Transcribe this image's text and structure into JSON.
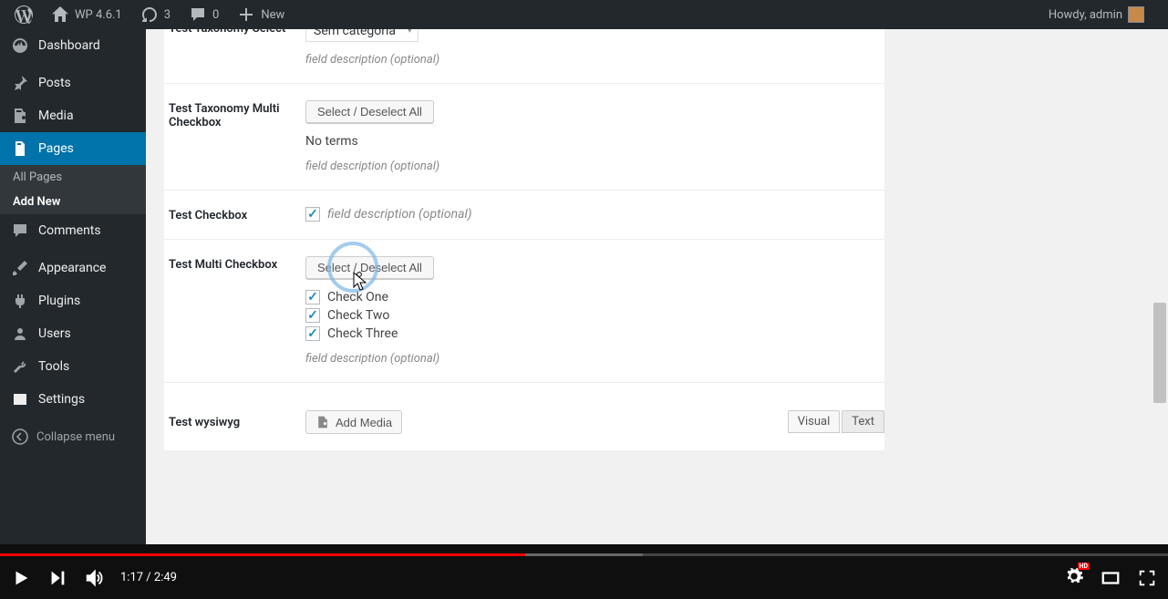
{
  "adminbar": {
    "site_title": "WP 4.6.1",
    "updates_count": "3",
    "comments_count": "0",
    "new_label": "New",
    "howdy": "Howdy, admin"
  },
  "sidebar": {
    "items": [
      {
        "id": "dashboard",
        "label": "Dashboard"
      },
      {
        "id": "posts",
        "label": "Posts"
      },
      {
        "id": "media",
        "label": "Media"
      },
      {
        "id": "pages",
        "label": "Pages"
      },
      {
        "id": "comments",
        "label": "Comments"
      },
      {
        "id": "appearance",
        "label": "Appearance"
      },
      {
        "id": "plugins",
        "label": "Plugins"
      },
      {
        "id": "users",
        "label": "Users"
      },
      {
        "id": "tools",
        "label": "Tools"
      },
      {
        "id": "settings",
        "label": "Settings"
      }
    ],
    "submenu_pages": {
      "all_pages": "All Pages",
      "add_new": "Add New"
    },
    "collapse_label": "Collapse menu"
  },
  "form": {
    "taxonomy_select": {
      "label": "Test Taxonomy Select",
      "value": "Sem categoria",
      "desc": "field description (optional)"
    },
    "taxonomy_multi": {
      "label": "Test Taxonomy Multi Checkbox",
      "select_all": "Select / Deselect All",
      "no_terms": "No terms",
      "desc": "field description (optional)"
    },
    "checkbox": {
      "label": "Test Checkbox",
      "checked": true,
      "desc": "field description (optional)"
    },
    "multi_checkbox": {
      "label": "Test Multi Checkbox",
      "select_all": "Select / Deselect All",
      "options": [
        {
          "label": "Check One",
          "checked": true
        },
        {
          "label": "Check Two",
          "checked": true
        },
        {
          "label": "Check Three",
          "checked": true
        }
      ],
      "desc": "field description (optional)"
    },
    "wysiwyg": {
      "label": "Test wysiwyg",
      "add_media": "Add Media",
      "tab_visual": "Visual",
      "tab_text": "Text"
    }
  },
  "video": {
    "current_time": "1:17",
    "duration": "2:49",
    "progress_pct": 45,
    "buffered_pct": 55
  }
}
